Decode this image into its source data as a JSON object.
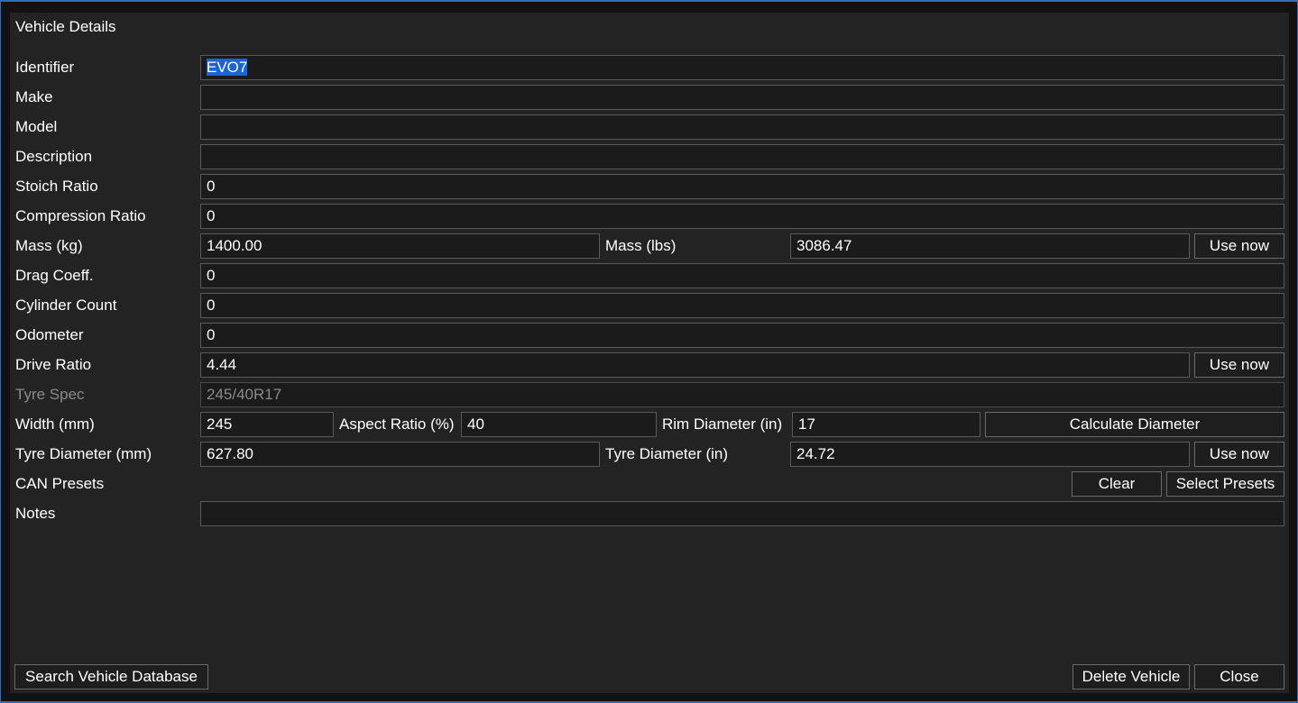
{
  "dialog": {
    "title": "Vehicle Details"
  },
  "fields": {
    "identifier": {
      "label": "Identifier",
      "value": "EVO7"
    },
    "make": {
      "label": "Make",
      "value": ""
    },
    "model": {
      "label": "Model",
      "value": ""
    },
    "description": {
      "label": "Description",
      "value": ""
    },
    "stoich_ratio": {
      "label": "Stoich Ratio",
      "value": "0"
    },
    "compression_ratio": {
      "label": "Compression Ratio",
      "value": "0"
    },
    "mass_kg": {
      "label": "Mass (kg)",
      "value": "1400.00"
    },
    "mass_lbs": {
      "label": "Mass (lbs)",
      "value": "3086.47"
    },
    "drag_coeff": {
      "label": "Drag Coeff.",
      "value": "0"
    },
    "cylinder_count": {
      "label": "Cylinder Count",
      "value": "0"
    },
    "odometer": {
      "label": "Odometer",
      "value": "0"
    },
    "drive_ratio": {
      "label": "Drive Ratio",
      "value": "4.44"
    },
    "tyre_spec": {
      "label": "Tyre Spec",
      "value": "245/40R17"
    },
    "width_mm": {
      "label": "Width (mm)",
      "value": "245"
    },
    "aspect_ratio": {
      "label": "Aspect Ratio (%)",
      "value": "40"
    },
    "rim_diameter": {
      "label": "Rim Diameter (in)",
      "value": "17"
    },
    "tyre_diameter_mm": {
      "label": "Tyre Diameter (mm)",
      "value": "627.80"
    },
    "tyre_diameter_in": {
      "label": "Tyre Diameter (in)",
      "value": "24.72"
    },
    "can_presets": {
      "label": "CAN Presets"
    },
    "notes": {
      "label": "Notes",
      "value": ""
    }
  },
  "buttons": {
    "use_now_mass": "Use now",
    "use_now_drive": "Use now",
    "calculate_diameter": "Calculate Diameter",
    "use_now_tyre": "Use now",
    "clear": "Clear",
    "select_presets": "Select Presets",
    "search_vehicle_database": "Search Vehicle Database",
    "delete_vehicle": "Delete Vehicle",
    "close": "Close"
  },
  "colors": {
    "accent": "#2a6fb8",
    "selection": "#1a64d6",
    "panel_bg": "#232323"
  }
}
